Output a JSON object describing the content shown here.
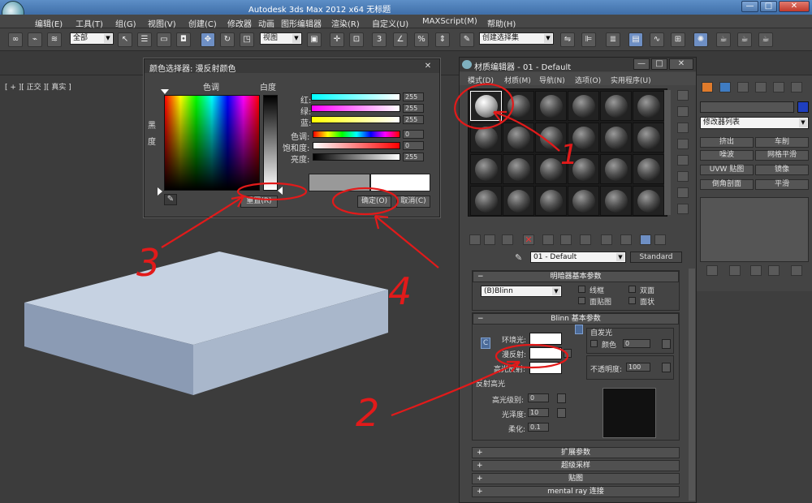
{
  "window": {
    "title": "Autodesk 3ds Max  2012 x64     无标题",
    "min": "—",
    "max": "□",
    "close": "✕"
  },
  "menu": [
    "编辑(E)",
    "工具(T)",
    "组(G)",
    "视图(V)",
    "创建(C)",
    "修改器",
    "动画",
    "图形编辑器",
    "渲染(R)",
    "自定义(U)",
    "MAXScript(M)",
    "帮助(H)"
  ],
  "toolbar": {
    "selection_filter": "全部",
    "ref_coord": "视图",
    "named_selection": "创建选择集"
  },
  "viewport": {
    "label": "[ + ][ 正交 ][ 真实 ]"
  },
  "color_dialog": {
    "title": "颜色选择器: 漫反射颜色",
    "hue_label": "色调",
    "whiteness_label": "白度",
    "blackness_label": "黑\n\n度",
    "channels": [
      {
        "label": "红:",
        "value": "255"
      },
      {
        "label": "绿:",
        "value": "255"
      },
      {
        "label": "蓝:",
        "value": "255"
      },
      {
        "label": "色调:",
        "value": "0"
      },
      {
        "label": "饱和度:",
        "value": "0"
      },
      {
        "label": "亮度:",
        "value": "255"
      }
    ],
    "reset": "重置(R)",
    "ok": "确定(O)",
    "cancel": "取消(C)"
  },
  "material_editor": {
    "title": "材质编辑器 - 01 - Default",
    "menus": [
      "模式(D)",
      "材质(M)",
      "导航(N)",
      "选项(O)",
      "实用程序(U)"
    ],
    "material_name": "01 - Default",
    "material_type": "Standard",
    "shader_rollout": "明暗器基本参数",
    "shader": "(B)Blinn",
    "shader_opts": [
      "线框",
      "双面",
      "面贴图",
      "面状"
    ],
    "blinn_rollout": "Blinn 基本参数",
    "self_illum": "自发光",
    "color_label": "颜色",
    "self_illum_val": "0",
    "ambient": "环境光:",
    "diffuse": "漫反射:",
    "specular": "高光反射:",
    "opacity_label": "不透明度:",
    "opacity": "100",
    "spec_highlights": "反射高光",
    "spec_level_label": "高光级别:",
    "spec_level": "0",
    "gloss_label": "光泽度:",
    "gloss": "10",
    "soften_label": "柔化:",
    "soften": "0.1",
    "rollouts": [
      "扩展参数",
      "超级采样",
      "贴图",
      "mental ray 连接"
    ]
  },
  "command_panel": {
    "modifier_list": "修改器列表",
    "buttons": [
      "挤出",
      "车削",
      "噪波",
      "网格平滑",
      "UVW 贴图",
      "镜像",
      "倒角剖面",
      "平滑"
    ]
  },
  "annotations": [
    "1",
    "2",
    "3",
    "4"
  ],
  "colors": {
    "accent_red": "#e21a1a",
    "title_blue": "#4a7bb6"
  }
}
